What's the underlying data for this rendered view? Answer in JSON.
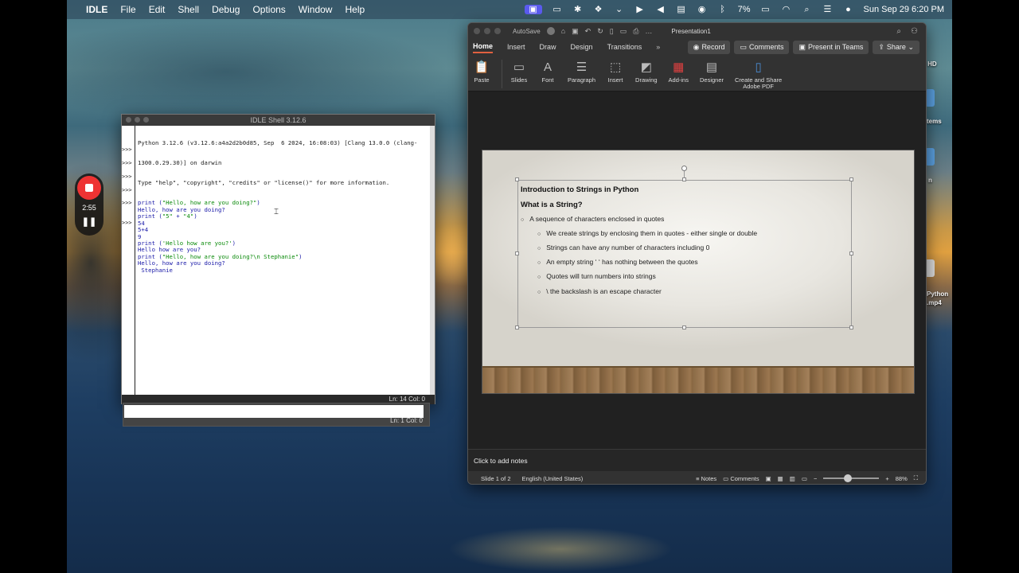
{
  "menubar": {
    "app": "IDLE",
    "items": [
      "File",
      "Edit",
      "Shell",
      "Debug",
      "Options",
      "Window",
      "Help"
    ],
    "battery": "7%",
    "datetime": "Sun Sep 29  6:20 PM"
  },
  "recorder": {
    "time": "2:55"
  },
  "idle": {
    "title": "IDLE Shell 3.12.6",
    "status": "Ln: 14  Col: 0",
    "status2": "Ln: 1  Col: 0",
    "banner1": "Python 3.12.6 (v3.12.6:a4a2d2b0d85, Sep  6 2024, 16:08:03) [Clang 13.0.0 (clang-",
    "banner2": "1300.0.29.30)] on darwin",
    "banner3": "Type \"help\", \"copyright\", \"credits\" or \"license()\" for more information.",
    "lines": [
      {
        "prompt": ">>>",
        "text": "print (\"Hello, how are you doing?\")",
        "kind": "in"
      },
      {
        "prompt": "",
        "text": "Hello, how are you doing?",
        "kind": "out"
      },
      {
        "prompt": ">>>",
        "text": "print (\"5\" + \"4\")",
        "kind": "in"
      },
      {
        "prompt": "",
        "text": "54",
        "kind": "out"
      },
      {
        "prompt": ">>>",
        "text": "5+4",
        "kind": "in"
      },
      {
        "prompt": "",
        "text": "9",
        "kind": "out"
      },
      {
        "prompt": ">>>",
        "text": "print ('Hello how are you?')",
        "kind": "in"
      },
      {
        "prompt": "",
        "text": "Hello how are you?",
        "kind": "out"
      },
      {
        "prompt": ">>>",
        "text": "print (\"Hello, how are you doing?\\n Stephanie\")",
        "kind": "in"
      },
      {
        "prompt": "",
        "text": "Hello, how are you doing?",
        "kind": "out"
      },
      {
        "prompt": "",
        "text": " Stephanie",
        "kind": "out"
      },
      {
        "prompt": ">>>",
        "text": "",
        "kind": "in"
      }
    ]
  },
  "ppt": {
    "autosave": "AutoSave",
    "doc": "Presentation1",
    "tabs": [
      "Home",
      "Insert",
      "Draw",
      "Design",
      "Transitions"
    ],
    "buttons": {
      "record": "Record",
      "comments": "Comments",
      "present": "Present in Teams",
      "share": "Share"
    },
    "ribbon": [
      "Paste",
      "Slides",
      "Font",
      "Paragraph",
      "Insert",
      "Drawing",
      "Add-ins",
      "Designer"
    ],
    "ribbon_last": "Create and Share\nAdobe PDF",
    "slide": {
      "title": "Introduction to Strings in Python",
      "subtitle": "What is a String?",
      "l1": "A sequence of characters enclosed in quotes",
      "l2": [
        "We create strings by enclosing them in quotes  - either single or double",
        "Strings can have any number of characters including 0",
        "An empty string ‘  ‘ has nothing between the quotes",
        "Quotes will turn numbers into strings",
        "\\ the backslash is an escape character"
      ]
    },
    "notes": "Click to add notes",
    "status": {
      "slide": "Slide 1 of 2",
      "lang": "English (United States)",
      "notes": "Notes",
      "comments": "Comments",
      "zoom": "88%"
    }
  },
  "desktop": {
    "items": [
      "h HD",
      "tems",
      "n",
      "Python",
      ".mp4"
    ]
  }
}
